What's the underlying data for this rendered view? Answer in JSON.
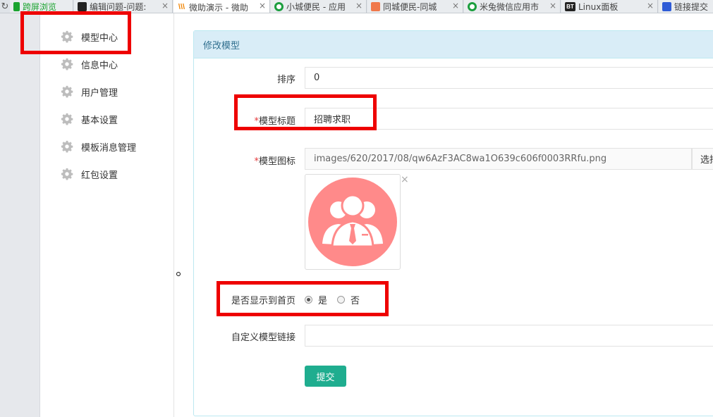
{
  "tabs": [
    {
      "title": "跨屏浏览",
      "icon": "phone-icon",
      "color": "#1aa32f"
    },
    {
      "title": "编辑问题-问题:",
      "icon": "film-icon",
      "color": "#222222"
    },
    {
      "title": "微助演示 - 微助",
      "icon": "vv-logo-icon",
      "color": "#f08300",
      "active": true
    },
    {
      "title": "小城便民 - 应用",
      "icon": "target-icon",
      "color": "#1b9e3e"
    },
    {
      "title": "同城便民-同城",
      "icon": "app-icon",
      "color": "#f0784b"
    },
    {
      "title": "米兔微信应用市",
      "icon": "target-icon",
      "color": "#1b9e3e"
    },
    {
      "title": "Linux面板",
      "icon": "bt-logo-icon",
      "color": "#222222",
      "badge": "BT"
    },
    {
      "title": "链接提交",
      "icon": "paw-icon",
      "color": "#2e5bd6"
    }
  ],
  "sidebar": {
    "items": [
      {
        "label": "模型中心"
      },
      {
        "label": "信息中心"
      },
      {
        "label": "用户管理"
      },
      {
        "label": "基本设置"
      },
      {
        "label": "模板消息管理"
      },
      {
        "label": "红包设置"
      }
    ]
  },
  "panel": {
    "title": "修改模型",
    "sort": {
      "label": "排序",
      "value": "0"
    },
    "model_title": {
      "required": "*",
      "label": "模型标题",
      "value": "招聘求职"
    },
    "model_icon": {
      "required": "*",
      "label": "模型图标",
      "value": "images/620/2017/08/qw6AzF3AC8wa1O639c606f0003RRfu.png",
      "pick_label": "选择",
      "close_glyph": "×",
      "icon_color": "#ff8a8a"
    },
    "show_home": {
      "label": "是否显示到首页",
      "options": [
        {
          "label": "是",
          "checked": true
        },
        {
          "label": "否",
          "checked": false
        }
      ]
    },
    "custom_link": {
      "label": "自定义模型链接",
      "value": ""
    },
    "submit_label": "提交"
  },
  "colors": {
    "highlight": "#ee0000",
    "submit": "#1fad8f",
    "heading_bg": "#d9edf7"
  }
}
